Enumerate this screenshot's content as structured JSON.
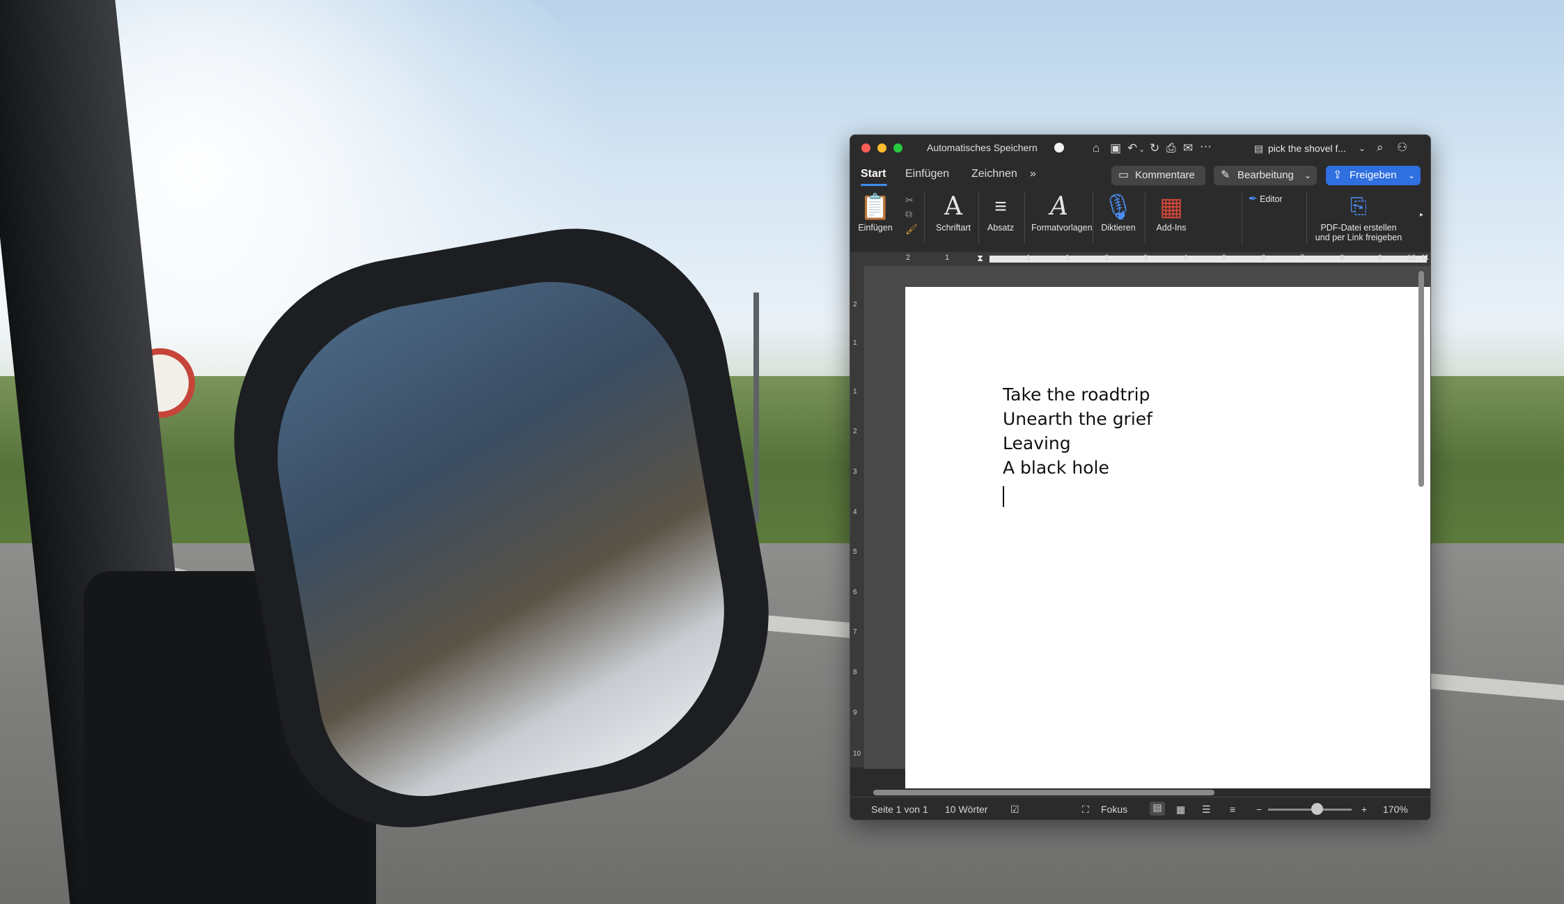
{
  "window": {
    "autosave_label": "Automatisches Speichern",
    "document_name": "pick the shovel f...",
    "colors": {
      "close": "#ff5f57",
      "minimize": "#febc2e",
      "zoom": "#28c840",
      "accent": "#2f6fe0"
    }
  },
  "tabs": [
    {
      "label": "Start"
    },
    {
      "label": "Einfügen"
    },
    {
      "label": "Zeichnen"
    }
  ],
  "more_tabs": "»",
  "header_buttons": {
    "comments": "Kommentare",
    "editing": "Bearbeitung",
    "share": "Freigeben"
  },
  "ribbon": {
    "paste": "Einfügen",
    "font": "Schriftart",
    "paragraph": "Absatz",
    "styles": "Formatvorlagen",
    "dictate": "Diktieren",
    "addins": "Add-Ins",
    "editor": "Editor",
    "pdf_line1": "PDF-Datei erstellen",
    "pdf_line2": "und per Link freigeben"
  },
  "ruler_labels": [
    "2",
    "1",
    "1",
    "1",
    "2",
    "3",
    "4",
    "5",
    "6",
    "7",
    "8",
    "9",
    "10",
    "11"
  ],
  "vruler_labels": [
    "2",
    "1",
    "1",
    "2",
    "3",
    "4",
    "5",
    "6",
    "7",
    "8",
    "9",
    "10"
  ],
  "document": {
    "lines": [
      "Take the roadtrip",
      "Unearth the grief",
      "Leaving",
      "A black hole"
    ]
  },
  "status": {
    "page": "Seite 1 von 1",
    "words": "10 Wörter",
    "focus": "Fokus",
    "zoom_minus": "−",
    "zoom_plus": "+",
    "zoom": "170%"
  }
}
